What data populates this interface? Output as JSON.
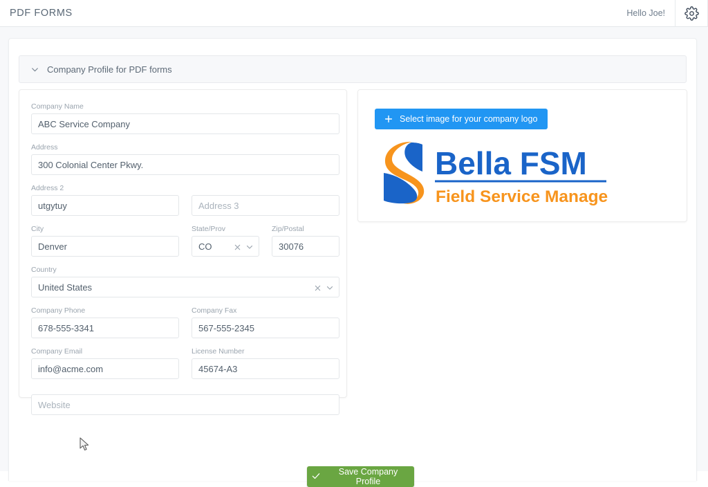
{
  "topbar": {
    "title": "PDF FORMS",
    "greeting": "Hello Joe!",
    "settings_icon": "gear-icon"
  },
  "accordion": {
    "title": "Company Profile for PDF forms",
    "chevron_icon": "chevron-down-icon",
    "expanded": true
  },
  "form": {
    "company_name": {
      "label": "Company Name",
      "value": "ABC Service Company",
      "placeholder": ""
    },
    "address": {
      "label": "Address",
      "value": "300 Colonial Center Pkwy.",
      "placeholder": ""
    },
    "address2": {
      "label": "Address 2",
      "value": "utgytuy",
      "placeholder": ""
    },
    "address3": {
      "label": "",
      "value": "",
      "placeholder": "Address 3"
    },
    "city": {
      "label": "City",
      "value": "Denver",
      "placeholder": ""
    },
    "state": {
      "label": "State/Prov",
      "value": "CO",
      "clear_icon": "close-icon",
      "chevron_icon": "chevron-down-icon"
    },
    "zip": {
      "label": "Zip/Postal",
      "value": "30076",
      "placeholder": ""
    },
    "country": {
      "label": "Country",
      "value": "United States",
      "clear_icon": "close-icon",
      "chevron_icon": "chevron-down-icon"
    },
    "phone": {
      "label": "Company Phone",
      "value": "678-555-3341",
      "placeholder": ""
    },
    "fax": {
      "label": "Company Fax",
      "value": "567-555-2345",
      "placeholder": ""
    },
    "email": {
      "label": "Company Email",
      "value": "info@acme.com",
      "placeholder": ""
    },
    "license": {
      "label": "License Number",
      "value": "45674-A3",
      "placeholder": ""
    },
    "website": {
      "label": "",
      "value": "",
      "placeholder": "Website"
    }
  },
  "logo_panel": {
    "select_button_label": "Select image for your company logo",
    "plus_icon": "plus-icon",
    "logo": {
      "name": "bella-fsm-logo",
      "title": "Bella FSM",
      "tagline": "Field Service Management",
      "blue": "#1a64c8",
      "orange": "#f7941d"
    }
  },
  "footer": {
    "save_label": "Save Company Profile",
    "save_icon": "check-icon",
    "save_color": "#6aa642"
  },
  "colors": {
    "accent_blue": "#2196f3",
    "page_bg": "#f7f8fa",
    "text": "#53606d",
    "label": "#9aa4ae"
  }
}
